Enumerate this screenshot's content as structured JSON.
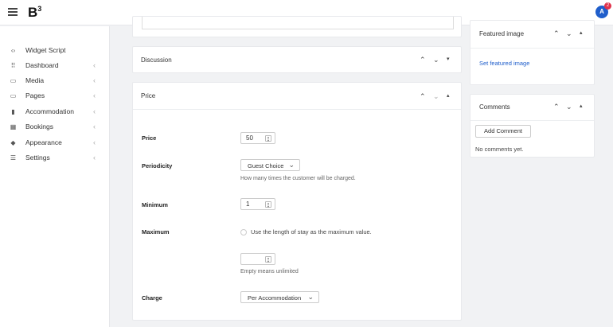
{
  "topbar": {
    "logo": "B",
    "logo_sup": "3",
    "avatar_initial": "A",
    "notification_count": "2"
  },
  "sidebar": {
    "items": [
      {
        "label": "Widget Script",
        "icon": "code-icon",
        "glyph": "‹›",
        "chevron": ""
      },
      {
        "label": "Dashboard",
        "icon": "grid-icon",
        "glyph": "⠿",
        "chevron": "‹"
      },
      {
        "label": "Media",
        "icon": "image-icon",
        "glyph": "▭",
        "chevron": "‹"
      },
      {
        "label": "Pages",
        "icon": "folder-icon",
        "glyph": "▭",
        "chevron": "‹"
      },
      {
        "label": "Accommodation",
        "icon": "building-icon",
        "glyph": "▮",
        "chevron": "‹"
      },
      {
        "label": "Bookings",
        "icon": "calendar-icon",
        "glyph": "▦",
        "chevron": "‹"
      },
      {
        "label": "Appearance",
        "icon": "paint-bucket-icon",
        "glyph": "◆",
        "chevron": "‹"
      },
      {
        "label": "Settings",
        "icon": "sliders-icon",
        "glyph": "☰",
        "chevron": "‹"
      }
    ]
  },
  "discussion": {
    "title": "Discussion"
  },
  "price_panel": {
    "title": "Price",
    "price_label": "Price",
    "price_value": "50",
    "periodicity_label": "Periodicity",
    "periodicity_value": "Guest Choice",
    "periodicity_hint": "How many times the customer will be charged.",
    "minimum_label": "Minimum",
    "minimum_value": "1",
    "maximum_label": "Maximum",
    "maximum_radio_label": "Use the length of stay as the maximum value.",
    "maximum_value": "",
    "maximum_hint": "Empty means unlimited",
    "charge_label": "Charge",
    "charge_value": "Per Accommodation"
  },
  "featured_image": {
    "title": "Featured image",
    "link": "Set featured image"
  },
  "comments": {
    "title": "Comments",
    "add_button": "Add Comment",
    "empty_text": "No comments yet."
  },
  "controls": {
    "up": "⌃",
    "down": "⌄",
    "collapse": "▴",
    "expand": "▾",
    "select_arrow": "⌄",
    "spin_up": "▲",
    "spin_down": "▼"
  },
  "colors": {
    "accent": "#1f5ecb",
    "badge": "#e0334c"
  }
}
